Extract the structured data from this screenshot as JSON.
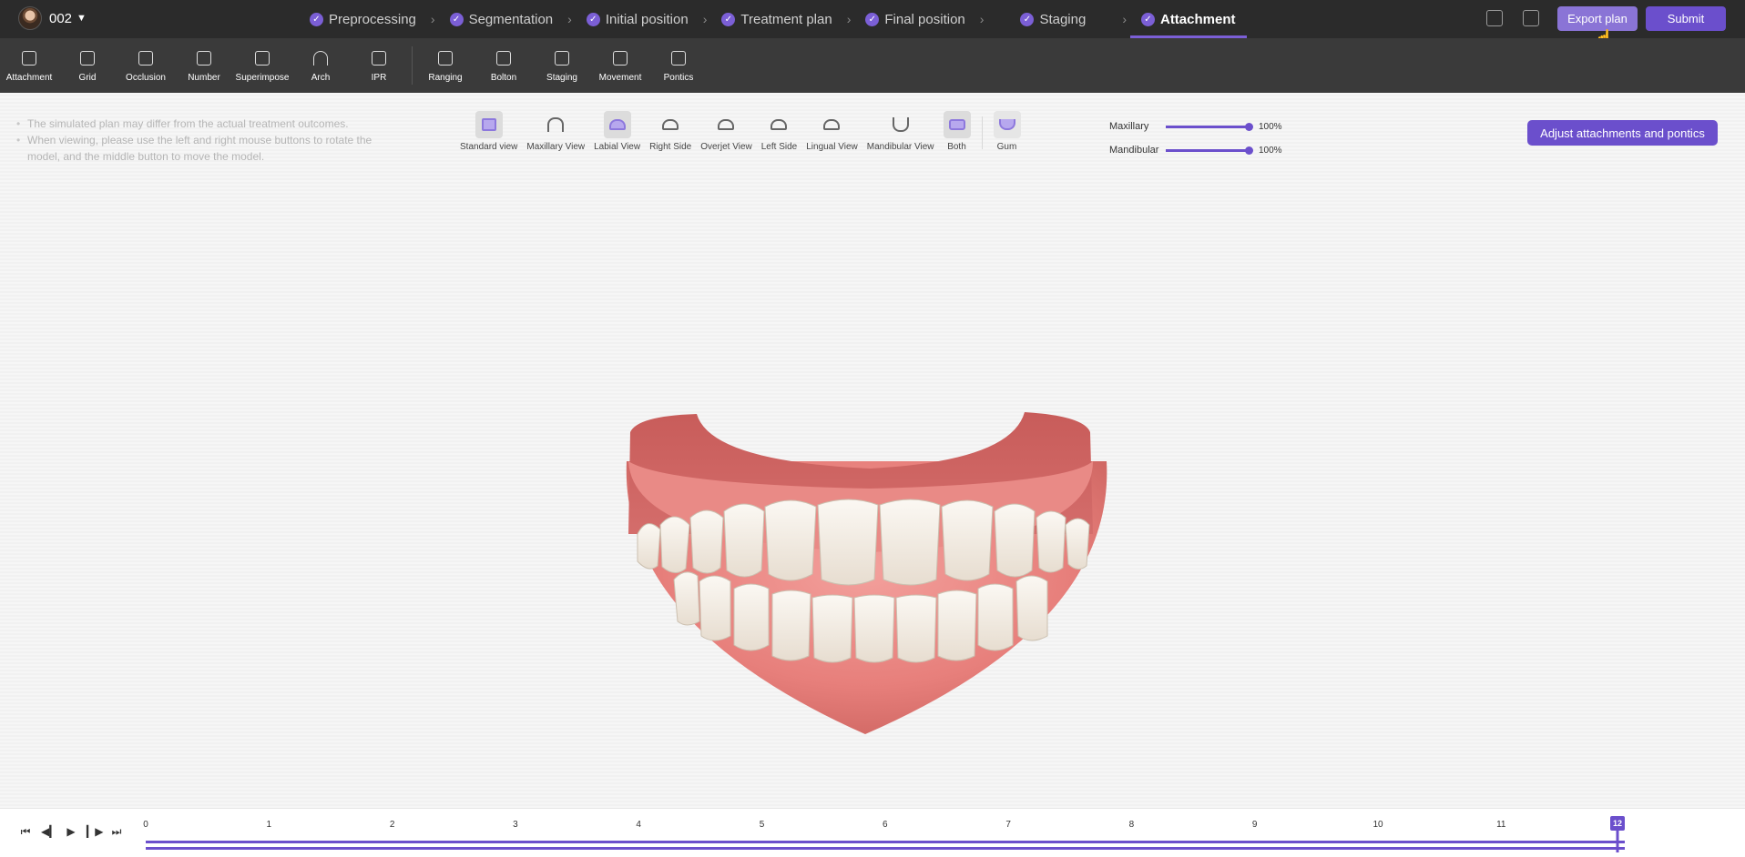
{
  "header": {
    "case_id": "002",
    "steps": [
      {
        "label": "Preprocessing",
        "done": true
      },
      {
        "label": "Segmentation",
        "done": true
      },
      {
        "label": "Initial position",
        "done": true
      },
      {
        "label": "Treatment plan",
        "done": true
      },
      {
        "label": "Final position",
        "done": true
      },
      {
        "label": "Staging",
        "done": true
      },
      {
        "label": "Attachment",
        "done": true,
        "active": true
      }
    ],
    "export_label": "Export plan",
    "submit_label": "Submit"
  },
  "toolbar": {
    "tools": [
      "Attachment",
      "Grid",
      "Occlusion",
      "Number",
      "Superimpose",
      "Arch",
      "IPR",
      "Ranging",
      "Bolton",
      "Staging",
      "Movement",
      "Pontics"
    ]
  },
  "notes": [
    "The simulated plan may differ from the actual treatment outcomes.",
    "When viewing, please use the left and right mouse buttons to rotate the model, and the middle button to move the model."
  ],
  "views": {
    "items": [
      "Standard view",
      "Maxillary View",
      "Labial View",
      "Right Side",
      "Overjet View",
      "Left Side",
      "Lingual View",
      "Mandibular View",
      "Both"
    ],
    "gum_label": "Gum"
  },
  "opacity": {
    "maxillary_label": "Maxillary",
    "maxillary_value": "100%",
    "mandibular_label": "Mandibular",
    "mandibular_value": "100%"
  },
  "adjust_button": "Adjust attachments and pontics",
  "timeline": {
    "ticks": [
      "0",
      "1",
      "2",
      "3",
      "4",
      "5",
      "6",
      "7",
      "8",
      "9",
      "10",
      "11"
    ],
    "current": "12",
    "max": 12
  },
  "colors": {
    "accent": "#6b4fcc",
    "gum": "#e07a78",
    "tooth": "#f1ebe2"
  }
}
